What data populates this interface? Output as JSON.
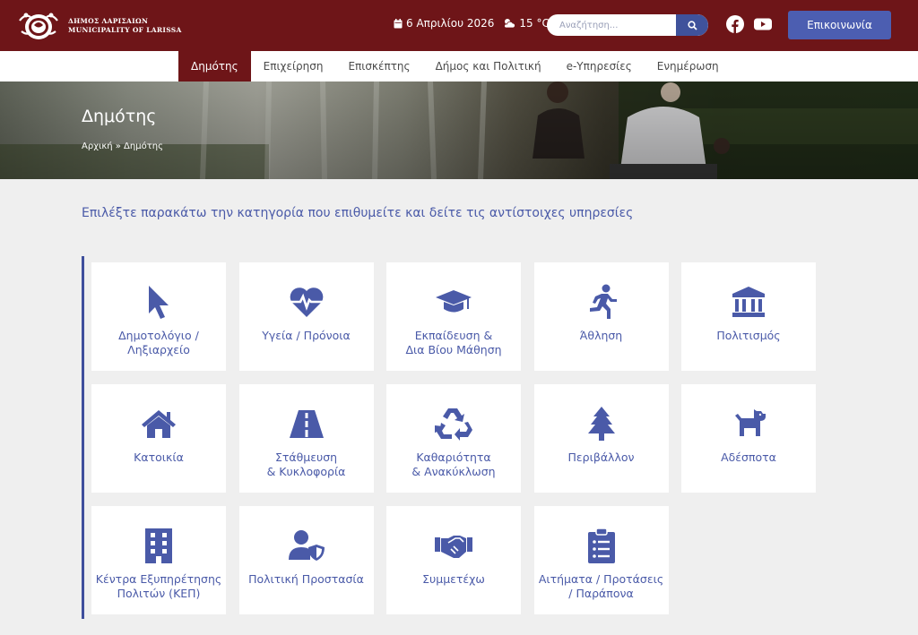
{
  "header": {
    "logo_line1": "ΔΗΜΟΣ ΛΑΡΙΣΑΙΩΝ",
    "logo_line2": "MUNICIPALITY OF LARISSA",
    "date": "6 Απριλίου 2026",
    "weather": "15 °C",
    "search_placeholder": "Αναζήτηση...",
    "contact_label": "Επικοινωνία"
  },
  "nav": {
    "items": [
      {
        "label": "Δημότης",
        "active": true
      },
      {
        "label": "Επιχείρηση"
      },
      {
        "label": "Επισκέπτης"
      },
      {
        "label": "Δήμος και Πολιτική"
      },
      {
        "label": "e-Υπηρεσίες"
      },
      {
        "label": "Ενημέρωση"
      }
    ]
  },
  "hero": {
    "title": "Δημότης",
    "breadcrumb": "Αρχική » Δημότης"
  },
  "intro": "Επιλέξτε παρακάτω την κατηγορία που επιθυμείτε και δείτε τις αντίστοιχες υπηρεσίες",
  "colors": {
    "brand": "#6e1518",
    "accent": "#4c5eb1",
    "icon": "#4a5aa8"
  },
  "categories": [
    {
      "label": "Δημοτολόγιο /\nΛηξιαρχείο",
      "icon": "cursor-icon"
    },
    {
      "label": "Υγεία / Πρόνοια",
      "icon": "heartbeat-icon"
    },
    {
      "label": "Εκπαίδευση &\nΔια Βίου Μάθηση",
      "icon": "graduation-cap-icon"
    },
    {
      "label": "Άθληση",
      "icon": "running-icon"
    },
    {
      "label": "Πολιτισμός",
      "icon": "museum-icon"
    },
    {
      "label": "Κατοικία",
      "icon": "home-icon"
    },
    {
      "label": "Στάθμευση\n& Κυκλοφορία",
      "icon": "road-icon"
    },
    {
      "label": "Καθαριότητα\n& Ανακύκλωση",
      "icon": "recycle-icon"
    },
    {
      "label": "Περιβάλλον",
      "icon": "tree-icon"
    },
    {
      "label": "Αδέσποτα",
      "icon": "dog-icon"
    },
    {
      "label": "Κέντρα Εξυπηρέτησης\nΠολιτών (ΚΕΠ)",
      "icon": "building-icon"
    },
    {
      "label": "Πολιτική Προστασία",
      "icon": "user-shield-icon"
    },
    {
      "label": "Συμμετέχω",
      "icon": "handshake-icon"
    },
    {
      "label": "Αιτήματα / Προτάσεις\n/ Παράπονα",
      "icon": "clipboard-list-icon"
    }
  ]
}
